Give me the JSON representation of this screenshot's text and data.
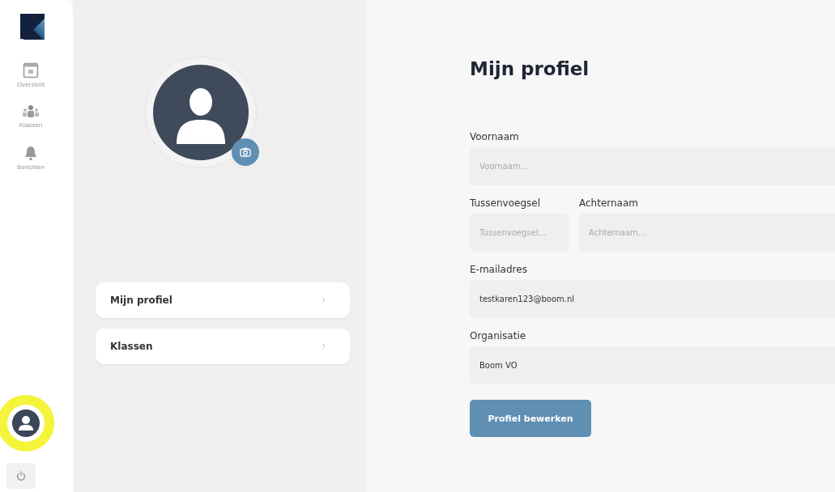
{
  "nav": {
    "items": [
      {
        "label": "Overzicht",
        "kind": "calendar"
      },
      {
        "label": "Klassen",
        "kind": "group"
      },
      {
        "label": "Berichten",
        "kind": "bell"
      }
    ],
    "account_highlighted": true
  },
  "profile_menu": [
    {
      "label": "Mijn profiel"
    },
    {
      "label": "Klassen"
    }
  ],
  "title": "Mijn profiel",
  "form": {
    "rows": [
      [
        {
          "label": "Voornaam",
          "placeholder": "Voornaam..."
        }
      ],
      [
        {
          "label": "Tussenvoegsel",
          "placeholder": "Tussenvoegsel..."
        },
        {
          "label": "Achternaam",
          "placeholder": "Achternaam..."
        }
      ],
      [
        {
          "label": "E-mailadres",
          "value": "testkaren123@boom.nl"
        }
      ],
      [
        {
          "label": "Organisatie",
          "value": "Boom VO"
        }
      ]
    ],
    "button": "Profiel bewerken"
  }
}
